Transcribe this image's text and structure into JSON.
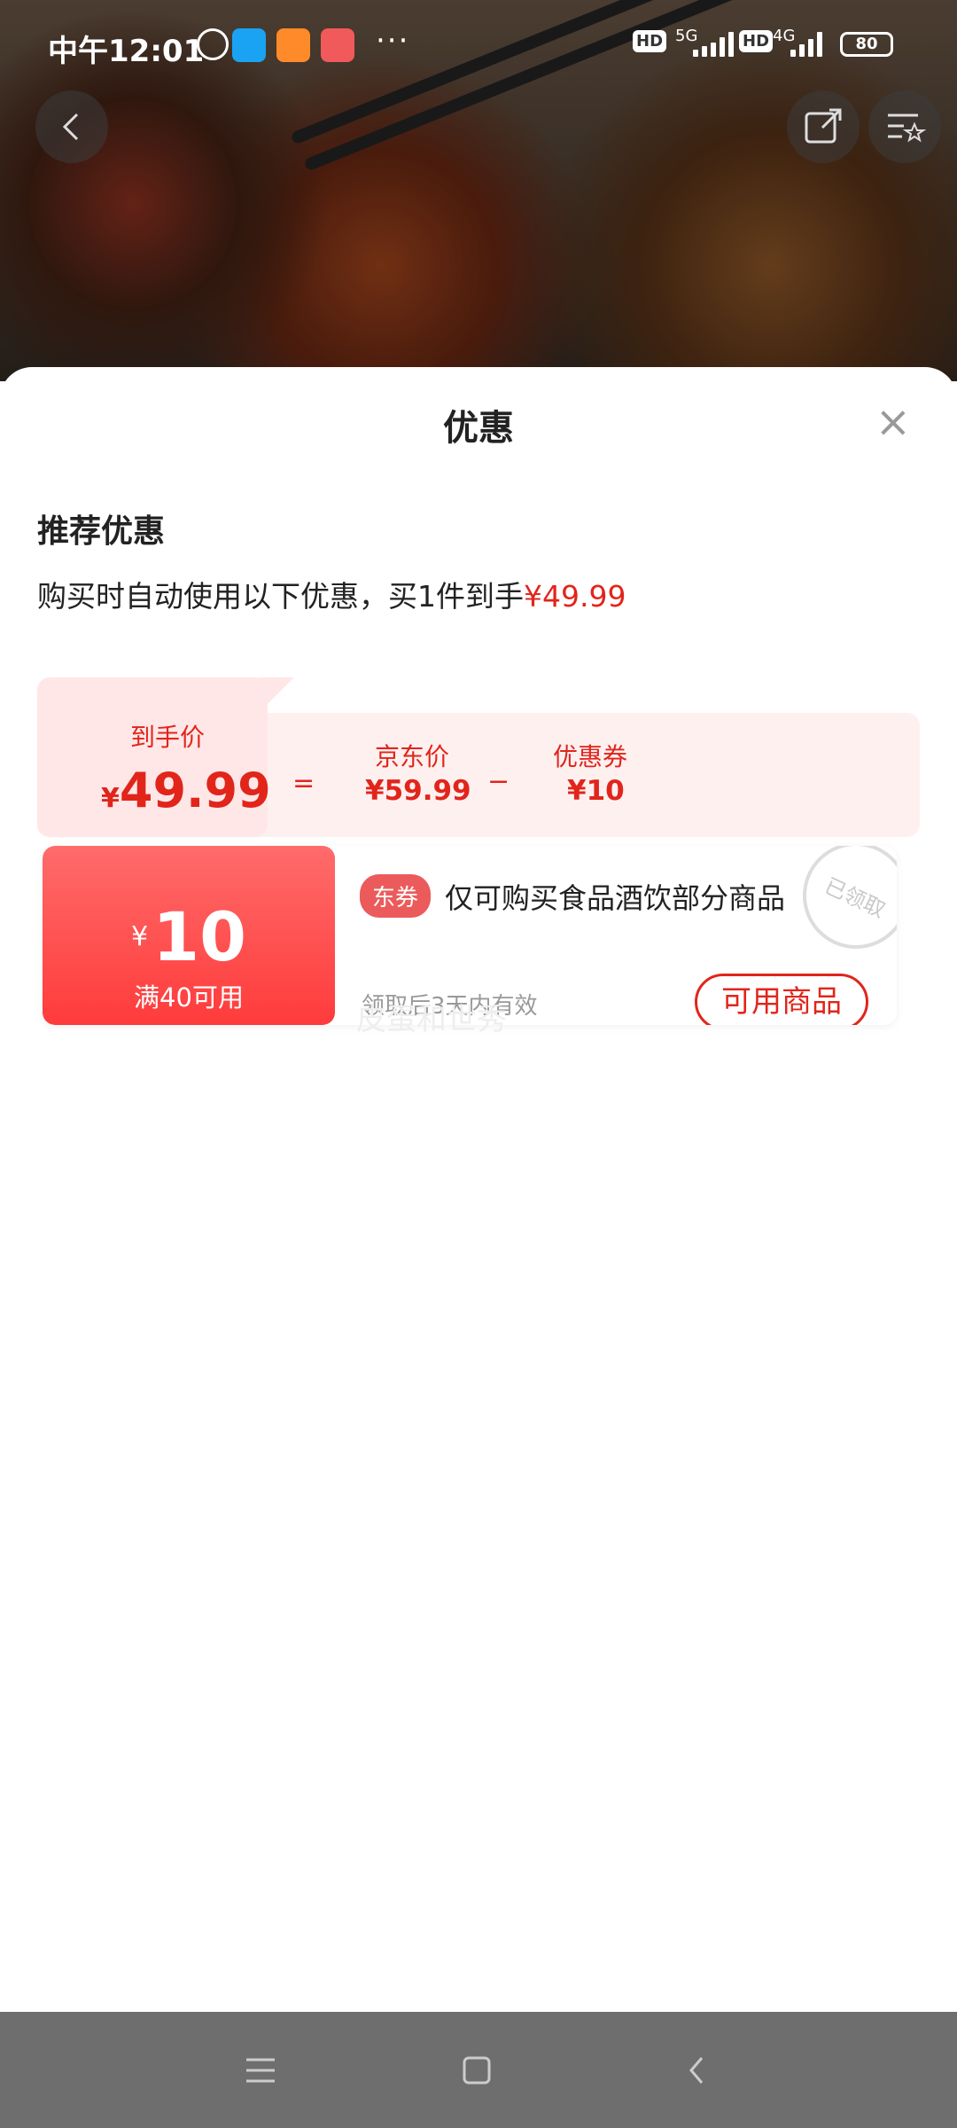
{
  "status_bar": {
    "time": "中午12:01",
    "network_1": "5G",
    "network_2": "4G",
    "hd": "HD",
    "battery": "80",
    "more": "···"
  },
  "hero": {
    "back_icon": "chevron-left-icon",
    "share_icon": "share-icon",
    "favorite_icon": "favorite-list-icon"
  },
  "sheet": {
    "title": "优惠",
    "close": "×",
    "section_title": "推荐优惠",
    "description_prefix": "购买时自动使用以下优惠，买1件到手",
    "description_price": "¥49.99"
  },
  "price_breakdown": {
    "final_label": "到手价",
    "final_yen": "¥",
    "final_value": "49.99",
    "equals": "=",
    "jd_label": "京东价",
    "jd_value": "¥59.99",
    "minus": "−",
    "coupon_label": "优惠券",
    "coupon_value": "¥10"
  },
  "coupon": {
    "yen": "¥",
    "amount": "10",
    "condition": "满40可用",
    "tag": "东券",
    "title": "仅可购买食品酒饮部分商品",
    "validity": "领取后3天内有效",
    "button": "可用商品",
    "stamp": "已领取"
  },
  "watermark": "皮蛋和世秀",
  "colors": {
    "accent": "#e1251b",
    "coupon_gradient_top": "#ff6b6b",
    "coupon_gradient_bottom": "#ff3b3b",
    "price_box_bg": "#fff0f0"
  }
}
